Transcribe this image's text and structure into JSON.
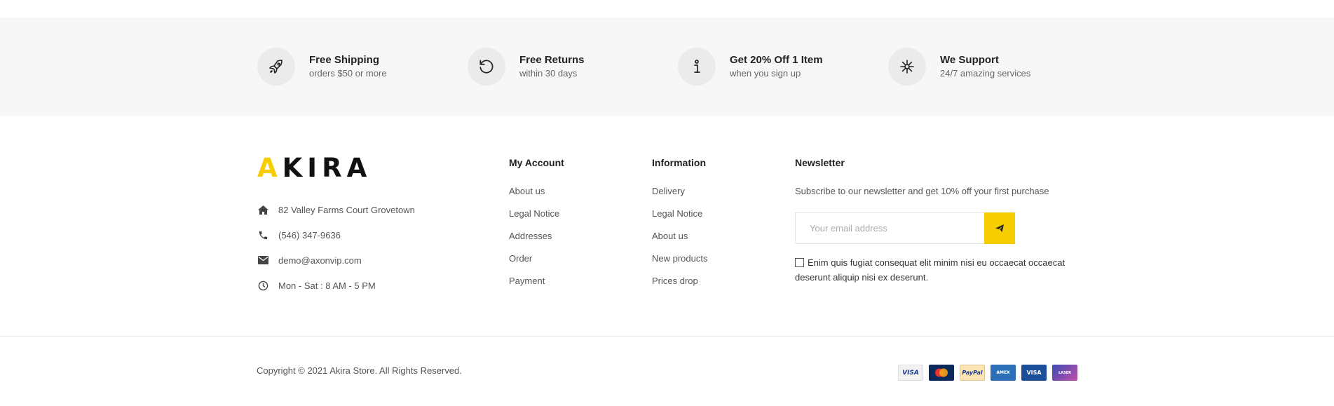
{
  "features": [
    {
      "icon": "rocket-icon",
      "title": "Free Shipping",
      "subtitle": "orders $50 or more"
    },
    {
      "icon": "refresh-icon",
      "title": "Free Returns",
      "subtitle": "within 30 days"
    },
    {
      "icon": "info-icon",
      "title": "Get 20% Off 1 Item",
      "subtitle": "when you sign up"
    },
    {
      "icon": "support-icon",
      "title": "We Support",
      "subtitle": "24/7 amazing services"
    }
  ],
  "brand": {
    "logo_first": "A",
    "logo_rest": "KIRA",
    "accent": "#f5cd00"
  },
  "contact": {
    "address": "82 Valley Farms Court Grovetown",
    "phone": "(546) 347-9636",
    "email": "demo@axonvip.com",
    "hours": "Mon - Sat : 8 AM - 5 PM"
  },
  "my_account": {
    "title": "My Account",
    "links": [
      "About us",
      "Legal Notice",
      "Addresses",
      "Order",
      "Payment"
    ]
  },
  "information": {
    "title": "Information",
    "links": [
      "Delivery",
      "Legal Notice",
      "About us",
      "New products",
      "Prices drop"
    ]
  },
  "newsletter": {
    "title": "Newsletter",
    "text": "Subscribe to our newsletter and get 10% off your first purchase",
    "placeholder": "Your email address",
    "consent": "Enim quis fugiat consequat elit minim nisi eu occaecat occaecat deserunt aliquip nisi ex deserunt."
  },
  "copyright": "Copyright © 2021 Akira Store. All Rights Reserved.",
  "payments": [
    {
      "name": "visa-icon",
      "label": "VISA"
    },
    {
      "name": "mastercard-icon",
      "label": "MC"
    },
    {
      "name": "paypal-icon",
      "label": "PayPal"
    },
    {
      "name": "amex-icon",
      "label": "AMEX"
    },
    {
      "name": "visa-electron-icon",
      "label": "VISA"
    },
    {
      "name": "laser-icon",
      "label": "LASER"
    }
  ]
}
